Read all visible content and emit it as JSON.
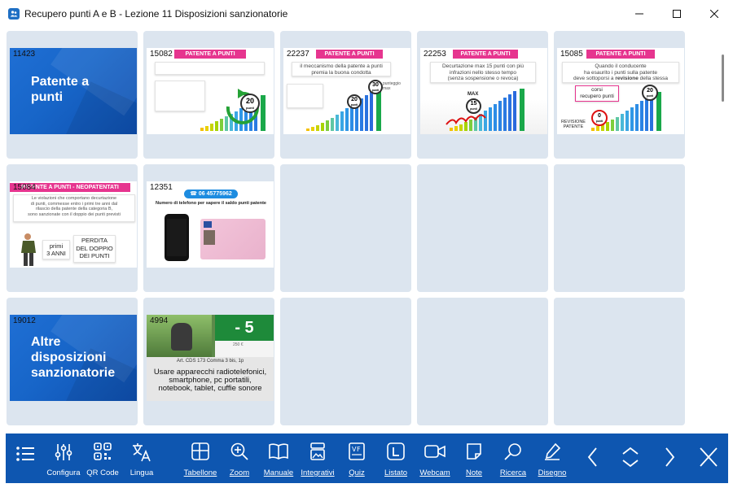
{
  "window": {
    "title": "Recupero punti A e B - Lezione 11 Disposizioni sanzionatorie"
  },
  "slides": {
    "s11423": {
      "num": "11423",
      "title_line1": "Patente a",
      "title_line2": "punti"
    },
    "s15082": {
      "num": "15082",
      "header": "PATENTE A PUNTI",
      "badge_value": "20",
      "badge_unit": "punti"
    },
    "s22237": {
      "num": "22237",
      "header": "PATENTE A PUNTI",
      "text": "il meccanismo della patente a punti premia la buona condotta",
      "badge_value": "30",
      "badge_unit": "punti",
      "badge_note": "punteggio max",
      "badge2_value": "20",
      "badge2_unit": "punti"
    },
    "s22253": {
      "num": "22253",
      "header": "PATENTE A PUNTI",
      "text_line1": "Decurtazione max 15 punti con più",
      "text_line2": "infrazioni nello stesso tempo",
      "text_line3": "(senza sospensione o revoca)",
      "max_label": "MAX",
      "max_value": "15",
      "max_unit": "punti"
    },
    "s15085": {
      "num": "15085",
      "header": "PATENTE A PUNTI",
      "text_line1": "Quando il conducente",
      "text_line2": "ha esaurito i punti sulla patente",
      "text_line3a": "deve sottoporsi a ",
      "text_line3b": "revisione",
      "text_line3c": " della stessa",
      "corsi_line1": "corsi",
      "corsi_line2": "recupero punti",
      "badge_value": "20",
      "badge_unit": "punti",
      "revisione_line1": "REVISIONE",
      "revisione_line2": "PATENTE",
      "zero_value": "0",
      "zero_unit": "punti"
    },
    "s15084": {
      "num": "15084",
      "header": "PATENTE A PUNTI - NEOPATENTATI",
      "text_line1": "Le violazioni che comportano decurtazione",
      "text_line2": "di punti, commesse entro i primi tre anni dal",
      "text_line3": "rilascio della patente della categoria B,",
      "text_line4": "sono sanzionate con il doppio dei punti previsti",
      "primi_line1": "primi",
      "primi_line2": "3 ANNI",
      "perdita_line1": "PERDITA",
      "perdita_line2": "DEL DOPPIO",
      "perdita_line3": "DEI PUNTI"
    },
    "s12351": {
      "num": "12351",
      "phone": "06 45775962",
      "caption": "Numero di telefono per sapere il saldo punti patente"
    },
    "s19012": {
      "num": "19012",
      "title_line1": "Altre",
      "title_line2": "disposizioni",
      "title_line3": "sanzionatorie"
    },
    "s4994": {
      "num": "4994",
      "minus": "- 5",
      "fine": "250 €",
      "article": "Art. CDS 173 Comma 3 bis, 1p",
      "desc_line1": "Usare apparecchi radiotelefonici,",
      "desc_line2": "smartphone, pc portatili,",
      "desc_line3": "notebook, tablet, cuffie sonore"
    }
  },
  "toolbar": {
    "configura": "Configura",
    "qrcode": "QR Code",
    "lingua": "Lingua",
    "tabellone": "Tabellone",
    "zoom": "Zoom",
    "manuale": "Manuale",
    "integrativi": "Integrativi",
    "quiz": "Quiz",
    "listato": "Listato",
    "webcam": "Webcam",
    "note": "Note",
    "ricerca": "Ricerca",
    "disegno": "Disegno"
  },
  "colors": {
    "toolbar_bg": "#0e56b0",
    "cell_bg": "#dce5ef",
    "slide_blue": "#1765c8",
    "pink_header": "#e6358f"
  }
}
